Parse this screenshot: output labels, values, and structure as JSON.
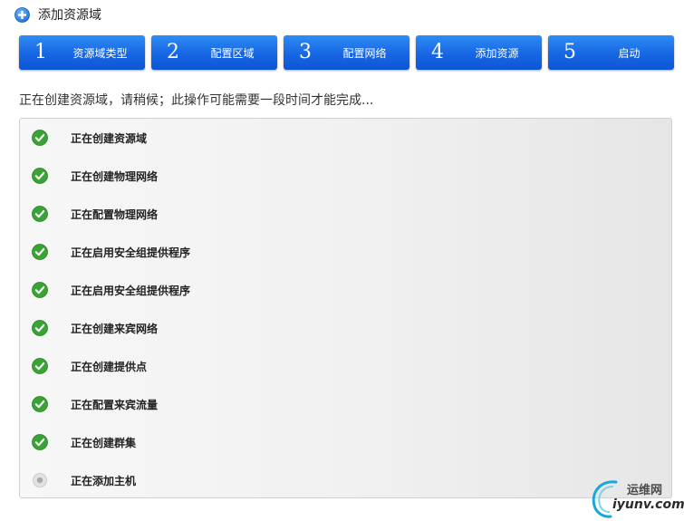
{
  "header": {
    "title": "添加资源域",
    "icon": "plus-circle-icon"
  },
  "steps": [
    {
      "number": "1",
      "label": "资源域类型"
    },
    {
      "number": "2",
      "label": "配置区域"
    },
    {
      "number": "3",
      "label": "配置网络"
    },
    {
      "number": "4",
      "label": "添加资源"
    },
    {
      "number": "5",
      "label": "启动"
    }
  ],
  "status_message": "正在创建资源域，请稍候；此操作可能需要一段时间才能完成...",
  "tasks": [
    {
      "label": "正在创建资源域",
      "status": "done",
      "icon": "check-circle-icon"
    },
    {
      "label": "正在创建物理网络",
      "status": "done",
      "icon": "check-circle-icon"
    },
    {
      "label": "正在配置物理网络",
      "status": "done",
      "icon": "check-circle-icon"
    },
    {
      "label": "正在启用安全组提供程序",
      "status": "done",
      "icon": "check-circle-icon"
    },
    {
      "label": "正在启用安全组提供程序",
      "status": "done",
      "icon": "check-circle-icon"
    },
    {
      "label": "正在创建来宾网络",
      "status": "done",
      "icon": "check-circle-icon"
    },
    {
      "label": "正在创建提供点",
      "status": "done",
      "icon": "check-circle-icon"
    },
    {
      "label": "正在配置来宾流量",
      "status": "done",
      "icon": "check-circle-icon"
    },
    {
      "label": "正在创建群集",
      "status": "done",
      "icon": "check-circle-icon"
    },
    {
      "label": "正在添加主机",
      "status": "in-progress",
      "icon": "pending-dot-icon"
    }
  ],
  "watermark": {
    "line1": "运维网",
    "line2": "iyunv.com"
  },
  "colors": {
    "step_button": "#1766e3",
    "done_green": "#3aa335",
    "pending_gray": "#bdbdbd"
  }
}
